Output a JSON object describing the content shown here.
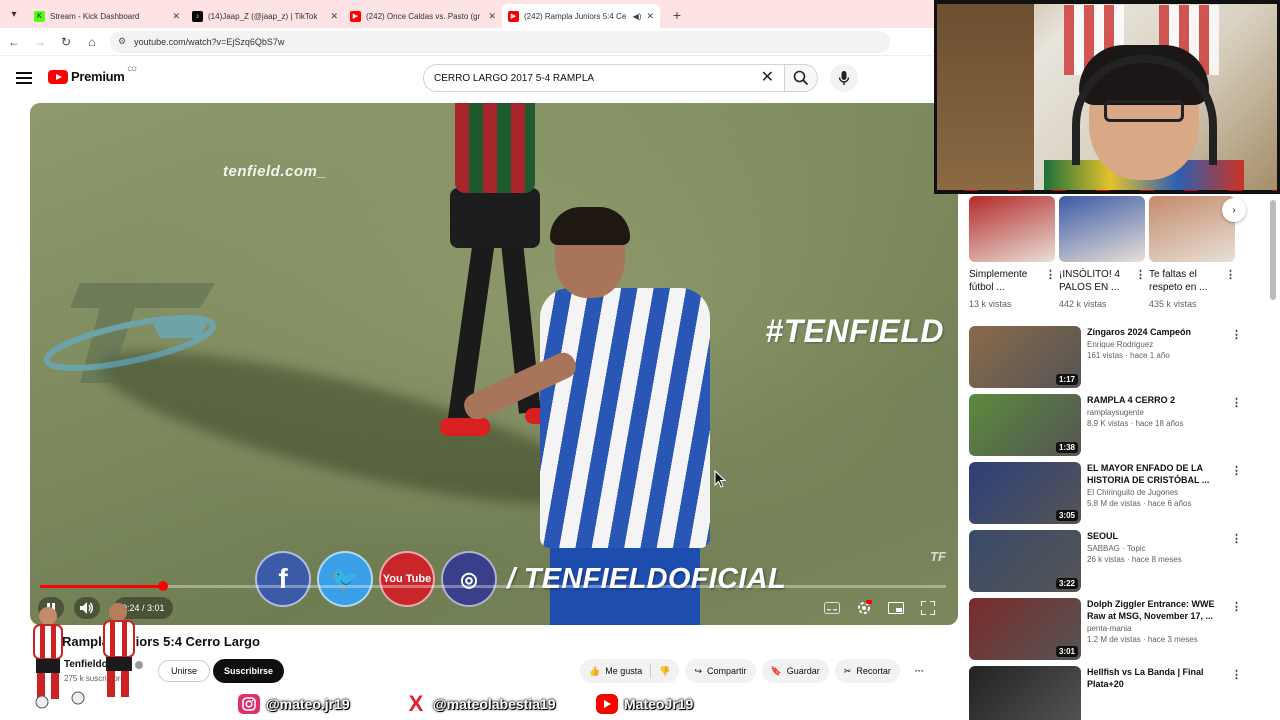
{
  "browser": {
    "tabs": [
      {
        "title": "Stream - Kick Dashboard",
        "icon": "kick-icon",
        "color": "#53fc18",
        "active": false
      },
      {
        "title": "(14)Jaap_Z (@jaap_z) | TikTok",
        "icon": "tiktok-icon",
        "color": "#000000",
        "active": false
      },
      {
        "title": "(242) Once Caldas vs. Pasto (gr",
        "icon": "youtube-icon",
        "color": "#ff0000",
        "active": false
      },
      {
        "title": "(242) Rampla Juniors 5:4 Ce",
        "icon": "youtube-icon",
        "color": "#ff0000",
        "active": true
      }
    ],
    "url": "youtube.com/watch?v=EjSzq6QbS7w"
  },
  "youtube": {
    "brand": "Premium",
    "brand_region": "CO",
    "search_value": "CERRO LARGO 2017 5-4 RAMPLA"
  },
  "video": {
    "watermark_url": "tenfield.com_",
    "watermark_tag": "#TENFIELD",
    "social_handle": "/ TENFIELDOFICIAL",
    "yt_badge": "You Tube",
    "corner_logo": "TF",
    "progress_fraction": 0.136,
    "time": "0:24 / 3:01",
    "title": "Rampla Juniors 5:4 Cerro Largo",
    "channel": "Tenfieldoficial",
    "subscribers": "275 k suscriptores",
    "join_label": "Unirse",
    "subscribe_label": "Suscribirse",
    "actions": {
      "like": "Me gusta",
      "share": "Compartir",
      "save": "Guardar",
      "clip": "Recortar"
    }
  },
  "sidebar": {
    "shorts": [
      {
        "title": "Simplemente fútbol ...",
        "views": "13 k vistas",
        "color": "#b52a2a"
      },
      {
        "title": "¡INSÓLITO! 4 PALOS EN ...",
        "views": "442 k vistas",
        "color": "#3b5aa6"
      },
      {
        "title": "Te faltas el respeto en ...",
        "views": "435 k vistas",
        "color": "#c48a6a"
      }
    ],
    "videos": [
      {
        "title": "Zíngaros 2024  Campeón",
        "channel": "Enrique Rodriguez",
        "stats": "161 vistas · hace 1 año",
        "duration": "1:17",
        "color": "#8a6a4a"
      },
      {
        "title": "RAMPLA 4 CERRO 2",
        "channel": "ramplaysugente",
        "stats": "8.9 K vistas · hace 18 años",
        "duration": "1:38",
        "color": "#5b8a3c"
      },
      {
        "title": "EL MAYOR ENFADO DE LA HISTORIA DE CRISTÓBAL ...",
        "channel": "El Chiringuito de Jugones",
        "stats": "5.8 M de vistas · hace 6 años",
        "duration": "3:05",
        "color": "#2d3f7a"
      },
      {
        "title": "SEOUL",
        "channel": "SABBAG · Topic",
        "stats": "26 k vistas · hace 8 meses",
        "duration": "3:22",
        "color": "#3a4a6a"
      },
      {
        "title": "Dolph Ziggler Entrance: WWE Raw at MSG, November 17, ...",
        "channel": "penta-mania",
        "stats": "1.2 M de vistas · hace 3 meses",
        "duration": "3:01",
        "color": "#7a2a2a"
      },
      {
        "title": "Hellfish vs La Banda  | Final Plata+20",
        "channel": "",
        "stats": "",
        "duration": "",
        "color": "#222222"
      }
    ]
  },
  "streamer_socials": [
    {
      "icon": "instagram-icon",
      "handle": "@mateo.jr19"
    },
    {
      "icon": "x-icon",
      "handle": "@mateolabestia19"
    },
    {
      "icon": "youtube-icon",
      "handle": "MateoJr19"
    }
  ]
}
